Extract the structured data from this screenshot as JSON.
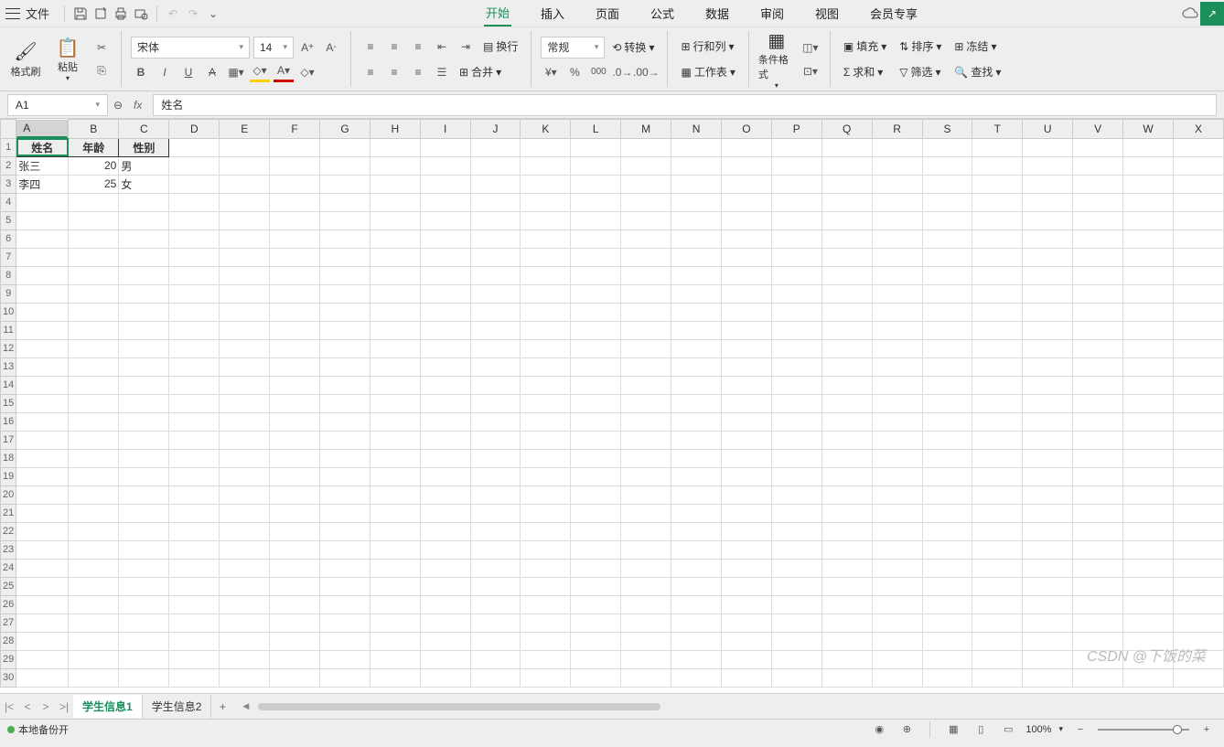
{
  "topbar": {
    "file_label": "文件"
  },
  "tabs": [
    "开始",
    "插入",
    "页面",
    "公式",
    "数据",
    "审阅",
    "视图",
    "会员专享"
  ],
  "active_tab": 0,
  "ribbon": {
    "format_brush": "格式刷",
    "paste": "粘贴",
    "font_name": "宋体",
    "font_size": "14",
    "wrap_label": "换行",
    "number_format": "常规",
    "convert": "转换",
    "rowcol": "行和列",
    "worksheet": "工作表",
    "cond_fmt": "条件格式",
    "merge": "合并",
    "fill": "填充",
    "sort": "排序",
    "freeze": "冻结",
    "sum": "求和",
    "filter": "筛选",
    "find": "查找"
  },
  "namebox": "A1",
  "formula_value": "姓名",
  "columns": [
    "A",
    "B",
    "C",
    "D",
    "E",
    "F",
    "G",
    "H",
    "I",
    "J",
    "K",
    "L",
    "M",
    "N",
    "O",
    "P",
    "Q",
    "R",
    "S",
    "T",
    "U",
    "V",
    "W",
    "X"
  ],
  "headers": {
    "A": "姓名",
    "B": "年龄",
    "C": "性别"
  },
  "rows": [
    {
      "A": "张三",
      "B": "20",
      "C": "男"
    },
    {
      "A": "李四",
      "B": "25",
      "C": "女"
    }
  ],
  "sheets": [
    "学生信息1",
    "学生信息2"
  ],
  "active_sheet": 0,
  "status": {
    "backup": "本地备份开",
    "zoom": "100%"
  },
  "watermark": "CSDN @下饭的菜"
}
